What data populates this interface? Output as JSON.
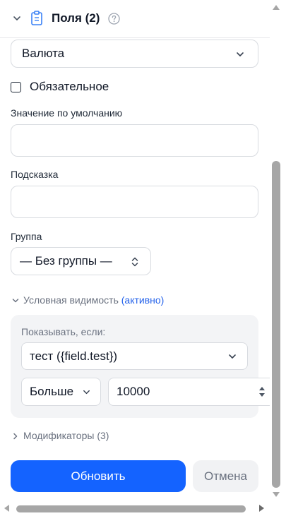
{
  "header": {
    "title": "Поля (2)"
  },
  "field": {
    "type_value": "Валюта",
    "required_label": "Обязательное",
    "default_label": "Значение по умолчанию",
    "default_value": "",
    "hint_label": "Подсказка",
    "hint_value": "",
    "group_label": "Группа",
    "group_value": "— Без группы —"
  },
  "conditional": {
    "title": "Условная видимость",
    "status": "(активно)",
    "show_if_label": "Показывать, если:",
    "field_value": "тест ({field.test})",
    "operator_value": "Больше",
    "compare_value": "10000"
  },
  "modifiers": {
    "title": "Модификаторы (3)"
  },
  "actions": {
    "update_label": "Обновить",
    "cancel_label": "Отмена"
  },
  "colors": {
    "primary": "#1463ff",
    "link": "#2563eb",
    "panel_bg": "#f3f4f6"
  }
}
